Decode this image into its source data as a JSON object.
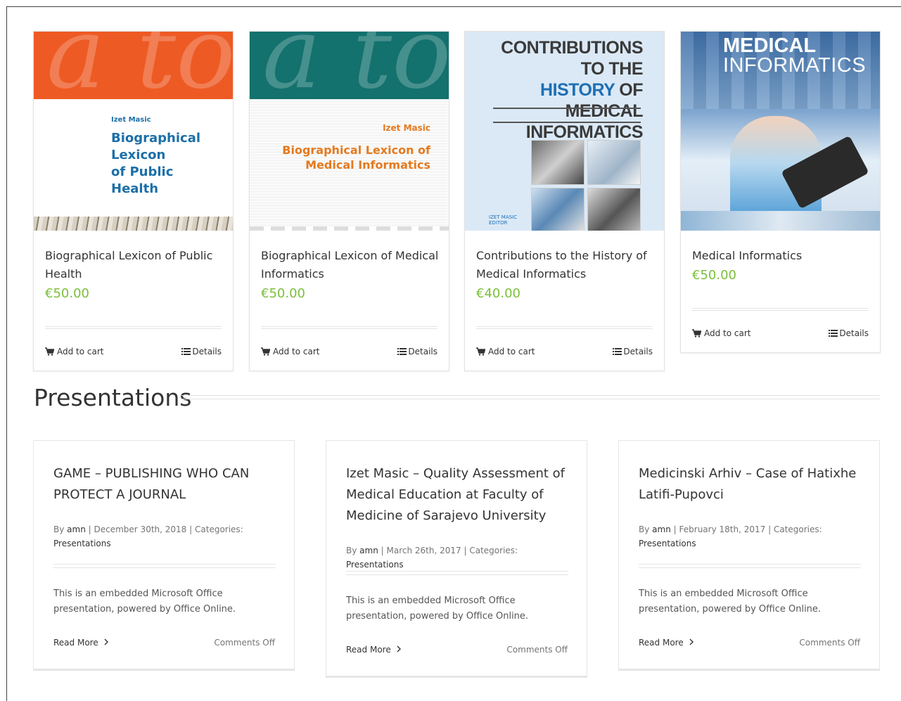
{
  "products": [
    {
      "title": "Biographical Lexicon of Public Health",
      "price": "€50.00",
      "add_to_cart": "Add to cart",
      "details": "Details",
      "cover": {
        "band_letters": "a to Z",
        "author": "Izet Masic",
        "title_lines": [
          "Biographical",
          "Lexicon",
          "of Public",
          "Health"
        ],
        "band_color": "#ee5a24"
      }
    },
    {
      "title": "Biographical Lexicon of Medical Informatics",
      "price": "€50.00",
      "add_to_cart": "Add to cart",
      "details": "Details",
      "cover": {
        "band_letters": "a to Z",
        "author": "Izet Masic",
        "title_lines": [
          "Biographical Lexicon of",
          "Medical Informatics"
        ],
        "band_color": "#13716e"
      }
    },
    {
      "title": "Contributions to the History of Medical Informatics",
      "price": "€40.00",
      "add_to_cart": "Add to cart",
      "details": "Details",
      "cover": {
        "title_lines": [
          "CONTRIBUTIONS TO THE",
          "HISTORY",
          "OF MEDICAL",
          "INFORMATICS"
        ],
        "tag_lines": [
          "IZET MASIC",
          "EDITOR"
        ]
      }
    },
    {
      "title": "Medical Informatics",
      "price": "€50.00",
      "add_to_cart": "Add to cart",
      "details": "Details",
      "cover": {
        "title_lines": [
          "MEDICAL",
          "INFORMATICS"
        ]
      }
    }
  ],
  "section": {
    "title": "Presentations"
  },
  "posts": [
    {
      "title": "GAME – PUBLISHING WHO CAN PROTECT A JOURNAL",
      "by": "By",
      "author": "amn",
      "date": "December 30th, 2018",
      "categories_label": "Categories:",
      "category": "Presentations",
      "excerpt": "This is an embedded Microsoft Office presentation, powered by Office Online.",
      "read_more": "Read More",
      "comments": "Comments Off"
    },
    {
      "title": "Izet Masic – Quality Assessment of Medical Education at Faculty of Medicine of Sarajevo University",
      "by": "By",
      "author": "amn",
      "date": "March 26th, 2017",
      "categories_label": "Categories:",
      "category": "Presentations",
      "excerpt": "This is an embedded Microsoft Office presentation, powered by Office Online.",
      "read_more": "Read More",
      "comments": "Comments Off"
    },
    {
      "title": "Medicinski Arhiv – Case of Hatixhe Latifi-Pupovci",
      "by": "By",
      "author": "amn",
      "date": "February 18th, 2017",
      "categories_label": "Categories:",
      "category": "Presentations",
      "excerpt": "This is an embedded Microsoft Office presentation, powered by Office Online.",
      "read_more": "Read More",
      "comments": "Comments Off"
    }
  ],
  "colors": {
    "price": "#7bbf3a",
    "text": "#333333",
    "meta": "#747474"
  },
  "icons": {
    "cart": "cart-icon",
    "details": "list-icon",
    "read_more": "chevron-right-icon"
  }
}
